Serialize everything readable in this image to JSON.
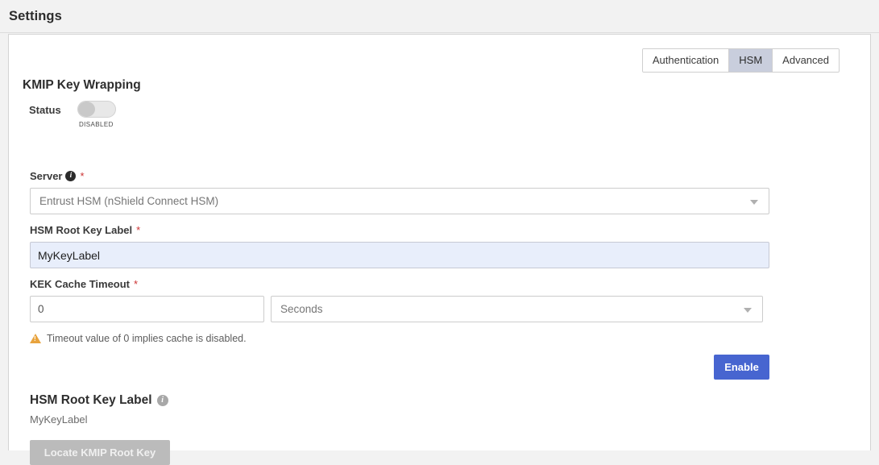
{
  "header": {
    "title": "Settings"
  },
  "tabs": [
    {
      "label": "Authentication",
      "active": false
    },
    {
      "label": "HSM",
      "active": true
    },
    {
      "label": "Advanced",
      "active": false
    }
  ],
  "section": {
    "title": "KMIP Key Wrapping",
    "status": {
      "label": "Status",
      "state_text": "DISABLED",
      "enabled": false
    },
    "server": {
      "label": "Server",
      "required_marker": "*",
      "info_icon": "info-icon",
      "value": "Entrust HSM (nShield Connect HSM)",
      "caret_icon": "chevron-down-icon"
    },
    "root_key_label": {
      "label": "HSM Root Key Label",
      "required_marker": "*",
      "value": "MyKeyLabel",
      "placeholder": "MyKeyLabel"
    },
    "kek_cache_timeout": {
      "label": "KEK Cache Timeout",
      "required_marker": "*",
      "value": "0",
      "placeholder": "0",
      "unit_value": "Seconds",
      "unit_caret_icon": "chevron-down-icon"
    },
    "warning": {
      "icon": "warning-triangle-icon",
      "text": "Timeout value of 0 implies cache is disabled."
    },
    "enable_button_label": "Enable"
  },
  "footer": {
    "heading": "HSM Root Key Label",
    "info_icon": "info-icon",
    "value": "MyKeyLabel",
    "locate_button_label": "Locate KMIP Root Key"
  },
  "colors": {
    "page_background": "#f2f2f2",
    "panel_background": "#ffffff",
    "primary_button": "#4765d0",
    "disabled_button": "#bbbbbb",
    "active_tab": "#c9cedd",
    "required_star": "#cc3333",
    "warning": "#e8a33d",
    "filled_input": "#e8eefb"
  }
}
